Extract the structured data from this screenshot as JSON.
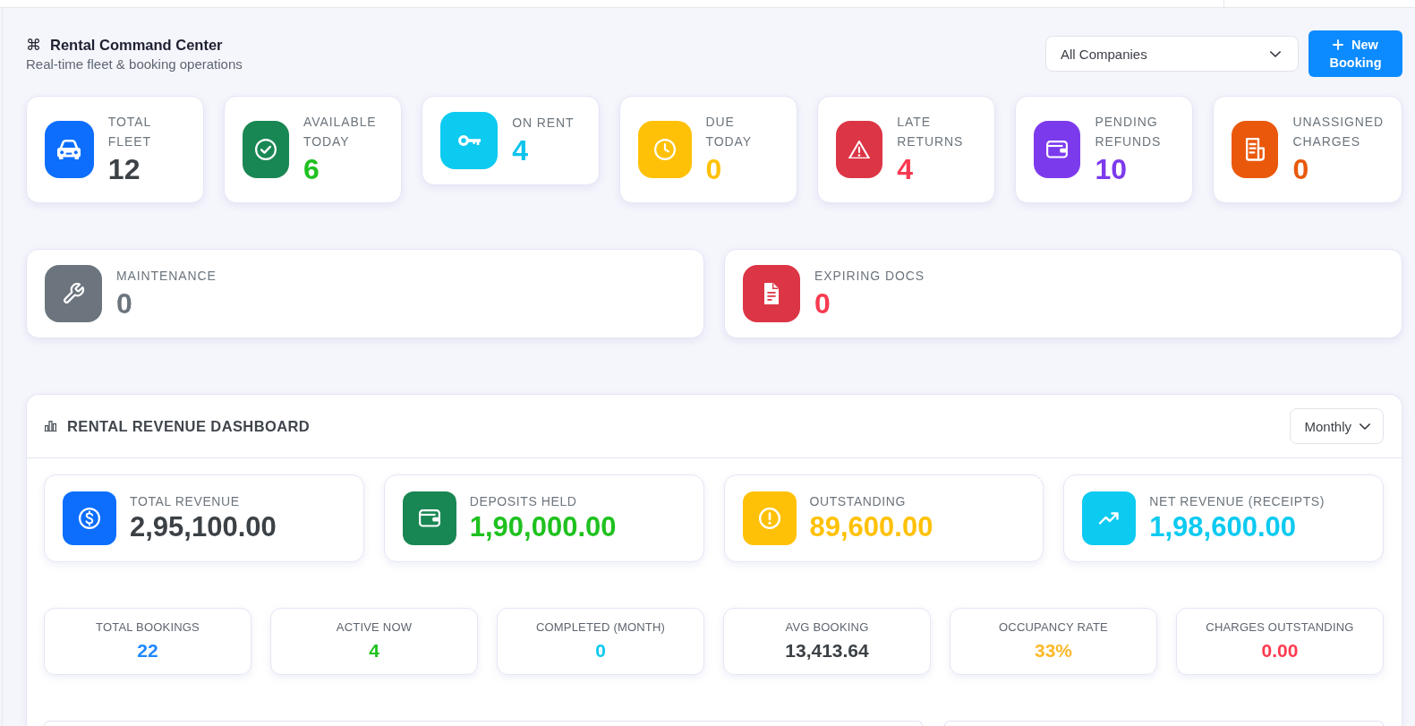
{
  "header": {
    "icon": "⌘",
    "title": "Rental Command Center",
    "subtitle": "Real-time fleet & booking operations",
    "company_filter": {
      "value": "All Companies"
    },
    "new_booking_button": {
      "label": "New Booking"
    }
  },
  "fleet_stats": [
    {
      "icon": {
        "color": "#0d6efd"
      },
      "label": "TOTAL FLEET",
      "value": "12",
      "color": "#3c4146"
    },
    {
      "icon": {
        "color": "#198754"
      },
      "label": "AVAILABLE TODAY",
      "value": "6",
      "color": "#1fc11f"
    },
    {
      "icon": {
        "color": "#0dcaf0"
      },
      "label": "ON RENT",
      "value": "4",
      "color": "#0dc3ec"
    },
    {
      "icon": {
        "color": "#ffc107"
      },
      "label": "DUE TODAY",
      "value": "0",
      "color": "#ffc107"
    },
    {
      "icon": {
        "color": "#dc3545"
      },
      "label": "LATE RETURNS",
      "value": "4",
      "color": "#f83a50"
    },
    {
      "icon": {
        "color": "#7c3aed"
      },
      "label": "PENDING REFUNDS",
      "value": "10",
      "color": "#7c3aed"
    },
    {
      "icon": {
        "color": "#ea580c"
      },
      "label": "UNASSIGNED CHARGES",
      "value": "0",
      "color": "#e8590c"
    }
  ],
  "alert_stats": [
    {
      "icon": {
        "color": "#6c757d"
      },
      "label": "MAINTENANCE",
      "value": "0",
      "color": "#6c757d"
    },
    {
      "icon": {
        "color": "#dc3545"
      },
      "label": "EXPIRING DOCS",
      "value": "0",
      "color": "#f83a50"
    }
  ],
  "revenue_dashboard": {
    "title": "RENTAL REVENUE DASHBOARD",
    "period_select": {
      "value": "Monthly"
    },
    "revenue_cards": [
      {
        "icon": {
          "color": "#0d6efd"
        },
        "label": "TOTAL REVENUE",
        "value": "2,95,100.00",
        "color": "#3c4146"
      },
      {
        "icon": {
          "color": "#198754"
        },
        "label": "DEPOSITS HELD",
        "value": "1,90,000.00",
        "color": "#1fc11f"
      },
      {
        "icon": {
          "color": "#ffc107"
        },
        "label": "OUTSTANDING",
        "value": "89,600.00",
        "color": "#ffc107"
      },
      {
        "icon": {
          "color": "#0dcaf0"
        },
        "label": "NET REVENUE (RECEIPTS)",
        "value": "1,98,600.00",
        "color": "#0dcaf0"
      }
    ],
    "booking_stats": [
      {
        "label": "TOTAL BOOKINGS",
        "value": "22",
        "color": "#2188ff"
      },
      {
        "label": "ACTIVE NOW",
        "value": "4",
        "color": "#1fc11f"
      },
      {
        "label": "COMPLETED (MONTH)",
        "value": "0",
        "color": "#0dcaf0"
      },
      {
        "label": "AVG BOOKING",
        "value": "13,413.64",
        "color": "#3c4146"
      },
      {
        "label": "OCCUPANCY RATE",
        "value": "33%",
        "color": "#fbb92b"
      },
      {
        "label": "CHARGES OUTSTANDING",
        "value": "0.00",
        "color": "#ff3b50"
      }
    ]
  }
}
